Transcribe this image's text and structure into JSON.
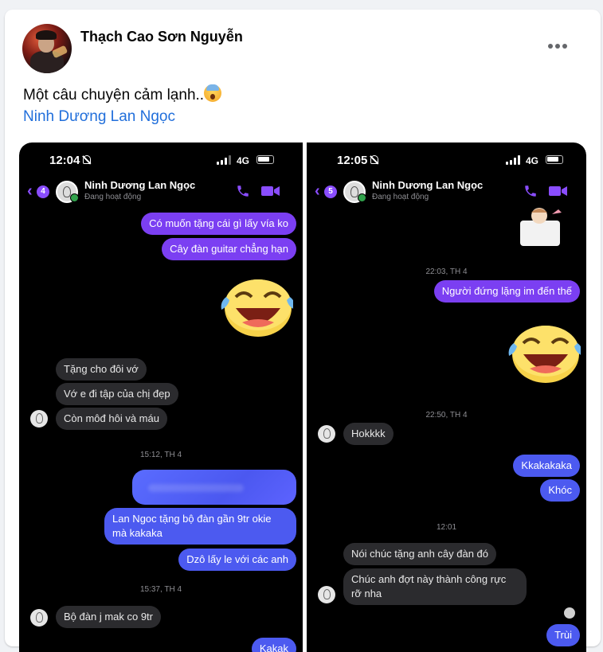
{
  "post": {
    "author": "Thạch Cao Sơn Nguyễn",
    "text": "Một câu chuyện cảm lạnh..",
    "emoji": "fearful-face-emoji",
    "tagged": "Ninh Dương Lan Ngọc",
    "more_icon": "more-horizontal-icon"
  },
  "colors": {
    "link": "#216fdb",
    "outgoing": "#7b3ff2",
    "outgoing_alt": "#4c5af0",
    "incoming": "#2b2b2e",
    "accent": "#8a4dff"
  },
  "left_screen": {
    "time": "12:04",
    "network": "4G",
    "badge": "4",
    "contact": "Ninh Dương Lan Ngọc",
    "presence": "Đang hoạt động",
    "messages": [
      "Có muốn tặng cái gì lấy vía ko",
      "Cây đàn guitar chẳng hạn",
      "Tặng cho đôi vớ",
      "Vớ e đi tập của chị đẹp",
      "Còn môđ hôi và máu",
      "Lan Ngoc tặng bộ đàn gần 9tr okie",
      "mà kakaka",
      "Dzô lấy le với các anh",
      "Bộ đàn j mak co 9tr",
      "Kakak"
    ],
    "timestamps": [
      "15:12, TH 4",
      "15:37, TH 4"
    ]
  },
  "right_screen": {
    "time": "12:05",
    "network": "4G",
    "badge": "5",
    "contact": "Ninh Dương Lan Ngọc",
    "presence": "Đang hoạt động",
    "messages": [
      "Người đứng lặng im đến thế",
      "Hokkkk",
      "Kkakakaka",
      "Khóc",
      "Nói chúc tặng anh cây đàn đó",
      "Chúc anh đợt này thành công rực rỡ nha",
      "Trùi"
    ],
    "timestamps": [
      "22:03, TH 4",
      "22:50, TH 4",
      "12:01"
    ]
  }
}
